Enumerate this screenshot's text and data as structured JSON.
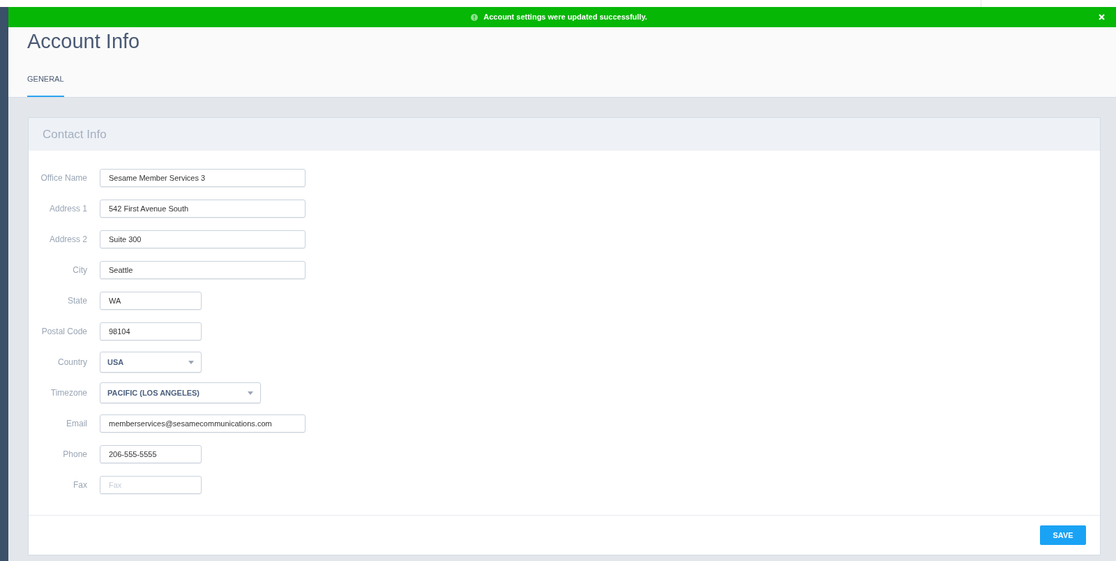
{
  "banner": {
    "message": "Account settings were updated successfully."
  },
  "page": {
    "title": "Account Info"
  },
  "tabs": [
    {
      "label": "GENERAL",
      "selected": true
    }
  ],
  "card": {
    "title": "Contact Info",
    "fields": [
      {
        "label": "Office Name",
        "kind": "text",
        "value": "Sesame Member Services 3"
      },
      {
        "label": "Address 1",
        "kind": "text",
        "value": "542 First Avenue South"
      },
      {
        "label": "Address 2",
        "kind": "text",
        "value": "Suite 300"
      },
      {
        "label": "City",
        "kind": "text",
        "value": "Seattle"
      },
      {
        "label": "State",
        "kind": "text",
        "value": "WA"
      },
      {
        "label": "Postal Code",
        "kind": "text",
        "value": "98104"
      },
      {
        "label": "Country",
        "kind": "select",
        "value": "USA"
      },
      {
        "label": "Timezone",
        "kind": "select",
        "value": "PACIFIC (LOS ANGELES)"
      },
      {
        "label": "Email",
        "kind": "text",
        "value": "memberservices@sesamecommunications.com"
      },
      {
        "label": "Phone",
        "kind": "text",
        "value": "206-555-5555"
      },
      {
        "label": "Fax",
        "kind": "text",
        "placeholder": "Fax"
      }
    ],
    "save_button": "SAVE"
  }
}
